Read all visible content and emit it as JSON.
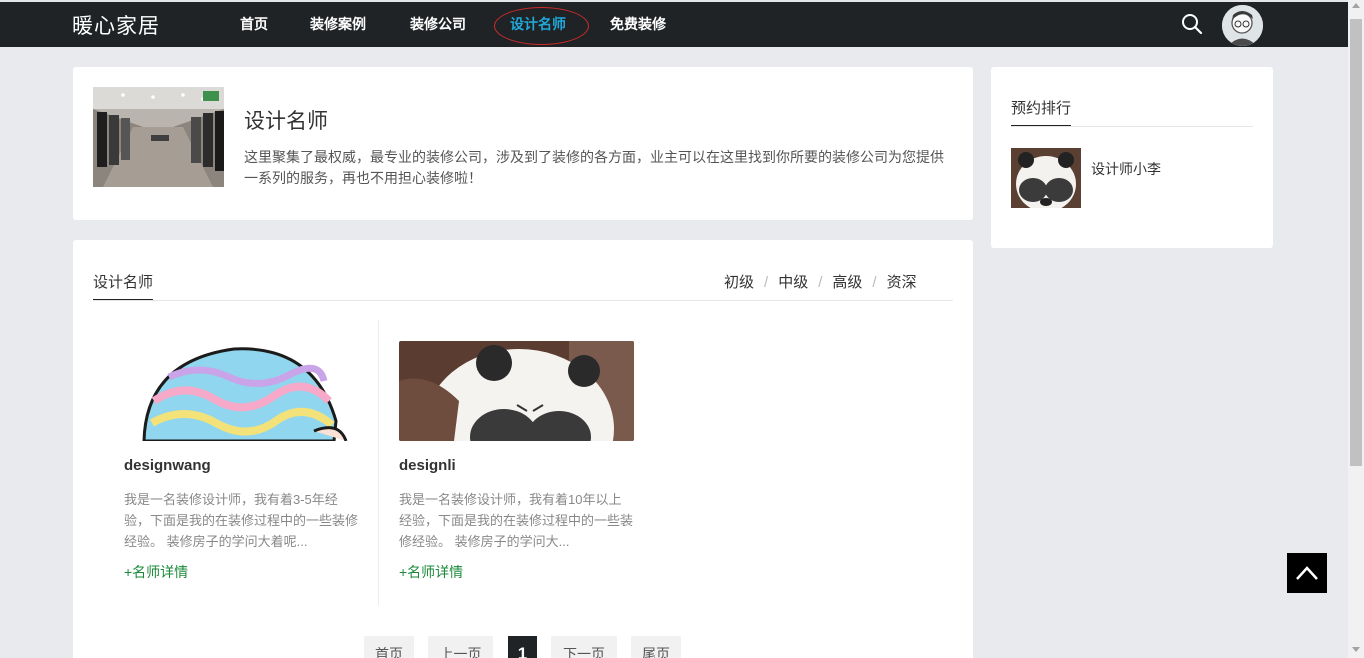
{
  "brand": {
    "logo_text": "暖心家居"
  },
  "nav": {
    "items": [
      {
        "label": "首页"
      },
      {
        "label": "装修案例"
      },
      {
        "label": "装修公司"
      },
      {
        "label": "设计名师",
        "active": true
      },
      {
        "label": "免费装修"
      }
    ]
  },
  "header_icons": [
    "search-icon",
    "user-avatar"
  ],
  "intro": {
    "title": "设计名师",
    "description": "这里聚集了最权威，最专业的装修公司，涉及到了装修的各方面，业主可以在这里找到你所要的装修公司为您提供一系列的服务，再也不用担心装修啦！"
  },
  "sidebar": {
    "tab": "预约排行",
    "items": [
      {
        "name": "设计师小李"
      }
    ]
  },
  "list": {
    "tab": "设计名师",
    "filters": [
      "初级",
      "中级",
      "高级",
      "资深"
    ],
    "designers": [
      {
        "name": "designwang",
        "desc": "我是一名装修设计师，我有着3-5年经验，下面是我的在装修过程中的一些装修经验。 装修房子的学问大着呢...",
        "link": "+名师详情"
      },
      {
        "name": "designli",
        "desc": "我是一名装修设计师，我有着10年以上经验，下面是我的在装修过程中的一些装修经验。 装修房子的学问大...",
        "link": "+名师详情"
      }
    ]
  },
  "pagination": {
    "first": "首页",
    "prev": "上一页",
    "current": "1",
    "next": "下一页",
    "last": "尾页"
  },
  "colors": {
    "topbar": "#1f2326",
    "accent": "#21a7d8",
    "link_green": "#1a8a3a",
    "highlight_ring": "#d02b2b"
  }
}
